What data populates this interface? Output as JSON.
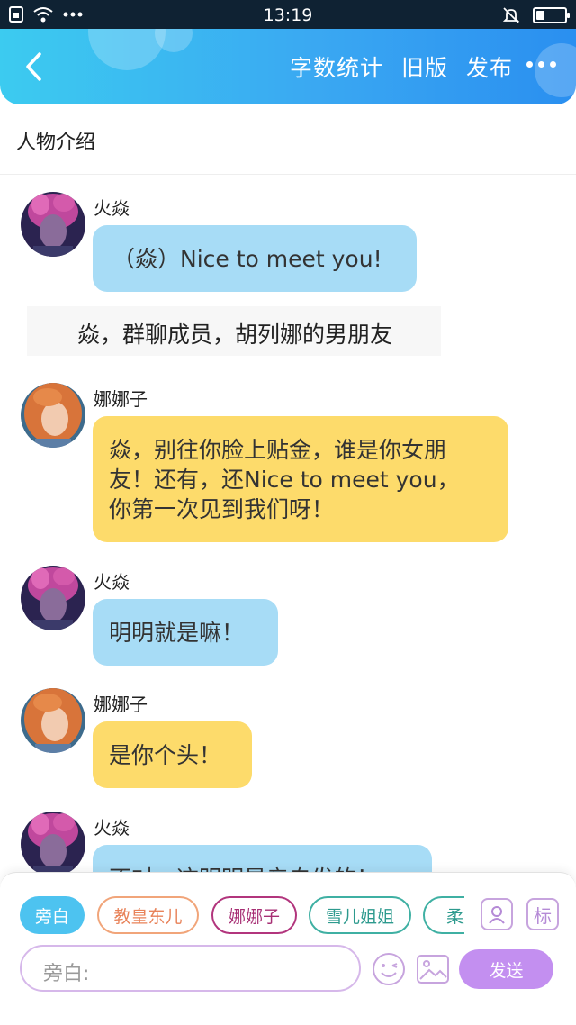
{
  "status_bar": {
    "time": "13:19"
  },
  "header": {
    "back_icon": "chevron-left-icon",
    "actions": [
      "字数统计",
      "旧版",
      "发布"
    ],
    "more_icon": "more-horizontal-icon"
  },
  "section": {
    "title": "人物介绍"
  },
  "messages": [
    {
      "sender": "火焱",
      "text": "（焱）Nice to meet you!",
      "color": "#a7dcf6"
    },
    {
      "narration": "焱，群聊成员，胡列娜的男朋友"
    },
    {
      "sender": "娜娜子",
      "lines": [
        "焱，别往你脸上贴金，谁是你女朋",
        "友！还有，还Nice to meet you，",
        "你第一次见到我们呀！"
      ],
      "color": "#fddb6b"
    },
    {
      "sender": "火焱",
      "text": "明明就是嘛！",
      "color": "#a7dcf6"
    },
    {
      "sender": "娜娜子",
      "text": "是你个头！",
      "color": "#fddb6b"
    },
    {
      "sender": "火焱",
      "text": "不对，这明明是亲自发的！",
      "color": "#a7dcf6"
    }
  ],
  "composer": {
    "chips": [
      "旁白",
      "教皇东儿",
      "娜娜子",
      "雪儿姐姐",
      "柔儿"
    ],
    "tool_avatar_icon": "person-card-icon",
    "tool_tag_label": "标",
    "input_label": "旁白:",
    "emoji_icon": "smile-icon",
    "image_icon": "image-icon",
    "send_label": "发送"
  }
}
